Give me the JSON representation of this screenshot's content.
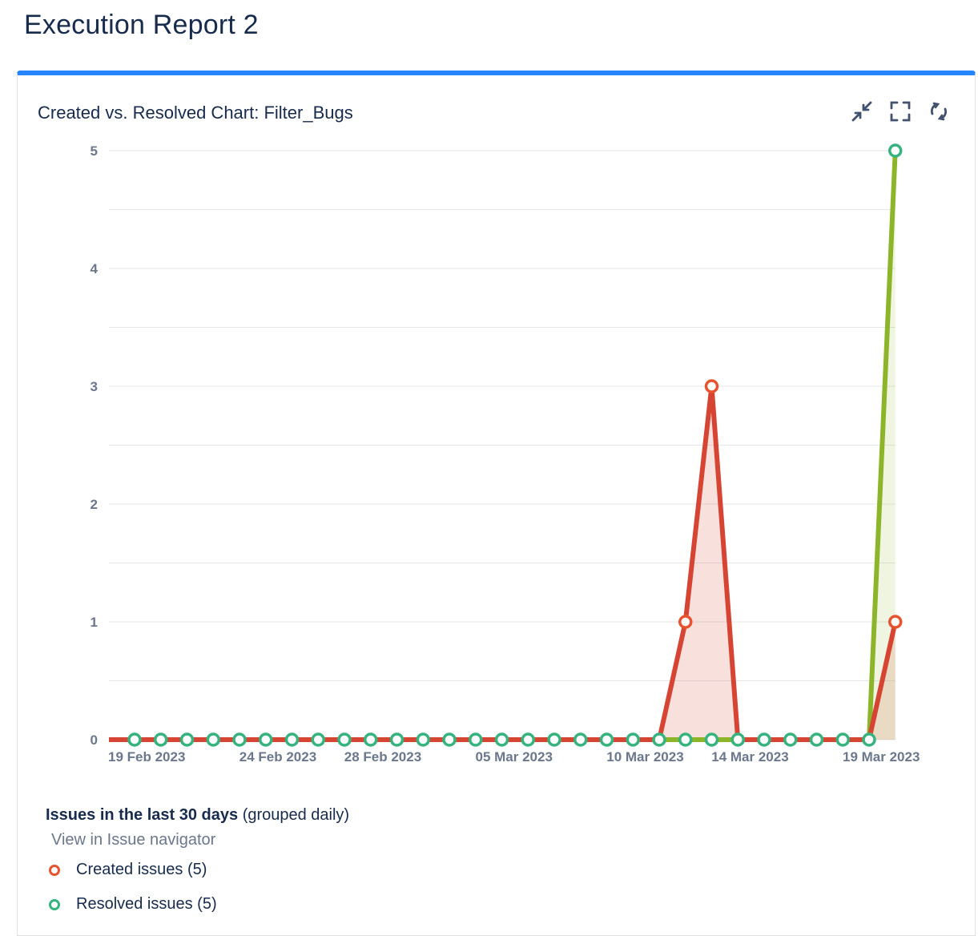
{
  "page": {
    "title": "Execution Report 2"
  },
  "gadget": {
    "title": "Created vs. Resolved Chart: Filter_Bugs",
    "tools": [
      {
        "name": "minimize-icon"
      },
      {
        "name": "fullscreen-icon"
      },
      {
        "name": "refresh-icon"
      }
    ]
  },
  "legend": {
    "heading_bold": "Issues in the last 30 days",
    "heading_rest": "(grouped daily)",
    "navigator_link": "View in Issue navigator",
    "items": [
      {
        "label": "Created issues (5)",
        "color": "#e8532f"
      },
      {
        "label": "Resolved issues (5)",
        "color": "#36b37e"
      }
    ]
  },
  "chart_data": {
    "type": "line",
    "x_start": "19 Feb 2023",
    "x": [
      "19 Feb 2023",
      "20 Feb 2023",
      "21 Feb 2023",
      "22 Feb 2023",
      "23 Feb 2023",
      "24 Feb 2023",
      "25 Feb 2023",
      "26 Feb 2023",
      "27 Feb 2023",
      "28 Feb 2023",
      "01 Mar 2023",
      "02 Mar 2023",
      "03 Mar 2023",
      "04 Mar 2023",
      "05 Mar 2023",
      "06 Mar 2023",
      "07 Mar 2023",
      "08 Mar 2023",
      "09 Mar 2023",
      "10 Mar 2023",
      "11 Mar 2023",
      "12 Mar 2023",
      "13 Mar 2023",
      "14 Mar 2023",
      "15 Mar 2023",
      "16 Mar 2023",
      "17 Mar 2023",
      "18 Mar 2023",
      "19 Mar 2023",
      "20 Mar 2023"
    ],
    "x_tick_labels": [
      "19 Feb 2023",
      "24 Feb 2023",
      "28 Feb 2023",
      "05 Mar 2023",
      "10 Mar 2023",
      "14 Mar 2023",
      "19 Mar 2023"
    ],
    "y_ticks": [
      "0",
      "1",
      "2",
      "3",
      "4",
      "5"
    ],
    "ylim": [
      0,
      5
    ],
    "grid": true,
    "series": [
      {
        "name": "Created issues (5)",
        "color": "#d64533",
        "values": [
          0,
          0,
          0,
          0,
          0,
          0,
          0,
          0,
          0,
          0,
          0,
          0,
          0,
          0,
          0,
          0,
          0,
          0,
          0,
          0,
          0,
          1,
          3,
          0,
          0,
          0,
          0,
          0,
          0,
          1
        ]
      },
      {
        "name": "Resolved issues (5)",
        "color": "#8db52a",
        "values": [
          0,
          0,
          0,
          0,
          0,
          0,
          0,
          0,
          0,
          0,
          0,
          0,
          0,
          0,
          0,
          0,
          0,
          0,
          0,
          0,
          0,
          0,
          0,
          0,
          0,
          0,
          0,
          0,
          0,
          5
        ]
      }
    ]
  }
}
